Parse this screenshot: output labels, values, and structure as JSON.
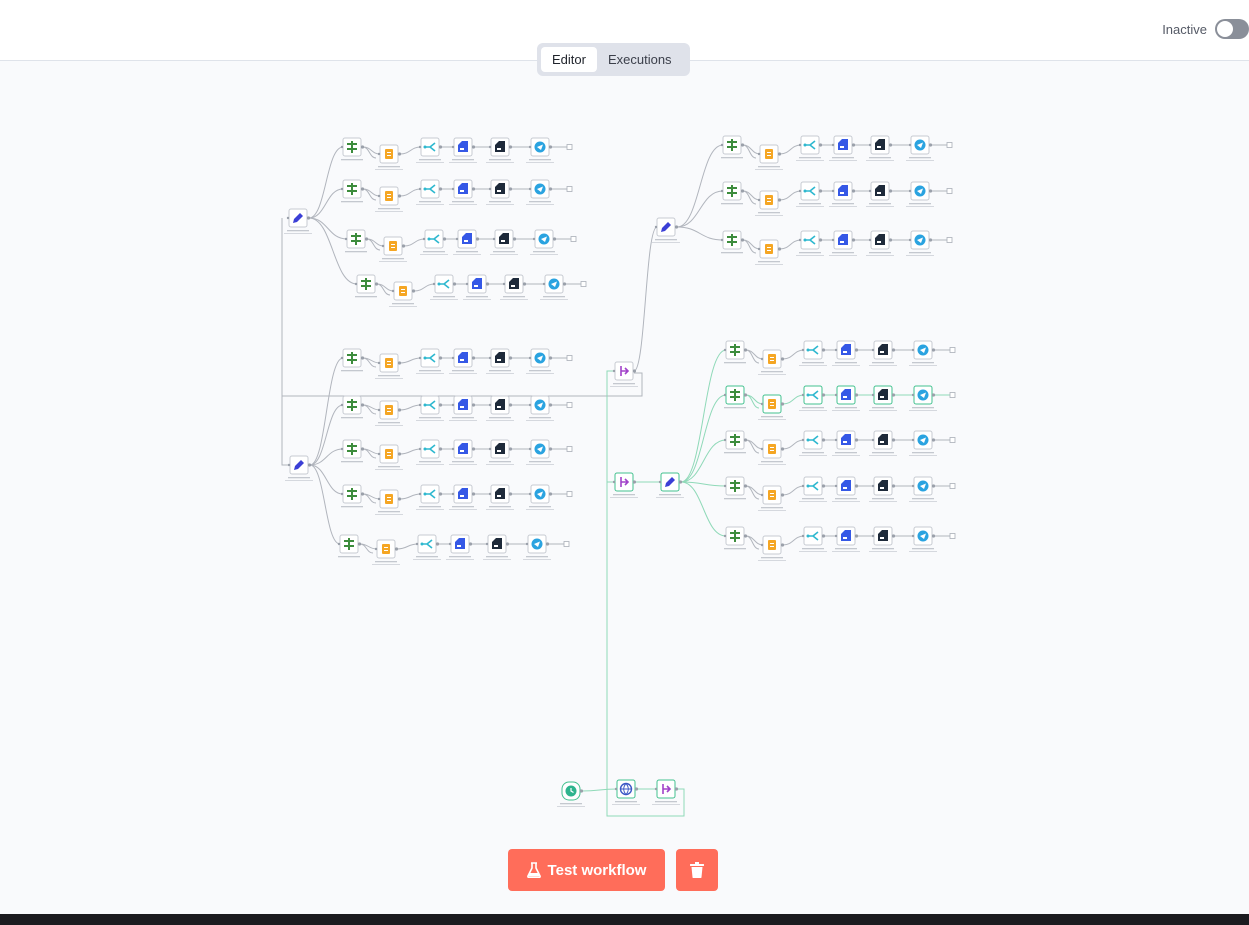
{
  "header": {
    "status_label": "Inactive",
    "toggle_on": false
  },
  "tabs": [
    {
      "label": "Editor",
      "active": true
    },
    {
      "label": "Executions",
      "active": false
    }
  ],
  "actions": {
    "test_label": "Test workflow",
    "delete_icon": "trash-icon",
    "test_icon": "flask-icon"
  },
  "colors": {
    "accent": "#ff6d5a",
    "edge": "#b1b5bd",
    "edge_active": "#8fd9b8",
    "node_border": "#c7cbd2",
    "set": "#3c8c3c",
    "code": "#f5a623",
    "split": "#2eb8cf",
    "upload": "#3558e6",
    "download": "#1e2a3a",
    "telegram": "#2aa3e0",
    "edit": "#3b3fd6",
    "wait": "#a142c9",
    "trigger": "#2db48d",
    "http": "#3b58c5"
  }
}
